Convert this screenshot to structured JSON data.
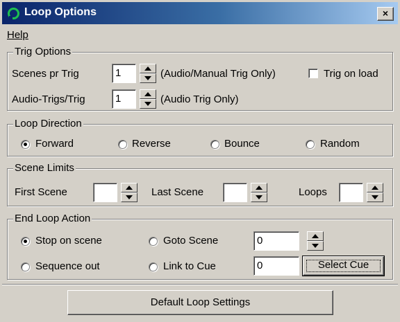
{
  "window": {
    "title": "Loop Options",
    "close_label": "×"
  },
  "menu": {
    "help": "Help"
  },
  "trig_options": {
    "legend": "Trig Options",
    "scenes_pr_trig_label": "Scenes pr Trig",
    "scenes_pr_trig_value": "1",
    "scenes_pr_trig_note": "(Audio/Manual Trig Only)",
    "trig_on_load_label": "Trig on load",
    "trig_on_load_checked": false,
    "audio_trigs_label": "Audio-Trigs/Trig",
    "audio_trigs_value": "1",
    "audio_trigs_note": "(Audio Trig Only)"
  },
  "loop_direction": {
    "legend": "Loop Direction",
    "options": [
      "Forward",
      "Reverse",
      "Bounce",
      "Random"
    ],
    "selected": "Forward"
  },
  "scene_limits": {
    "legend": "Scene Limits",
    "first_scene_label": "First Scene",
    "first_scene_value": "",
    "last_scene_label": "Last Scene",
    "last_scene_value": "",
    "loops_label": "Loops",
    "loops_value": ""
  },
  "end_loop_action": {
    "legend": "End Loop Action",
    "options": [
      "Stop on scene",
      "Goto Scene",
      "Sequence out",
      "Link to Cue"
    ],
    "selected": "Stop on scene",
    "goto_scene_value": "0",
    "link_to_cue_value": "0",
    "select_cue_label": "Select Cue"
  },
  "footer": {
    "default_button_label": "Default Loop Settings"
  }
}
